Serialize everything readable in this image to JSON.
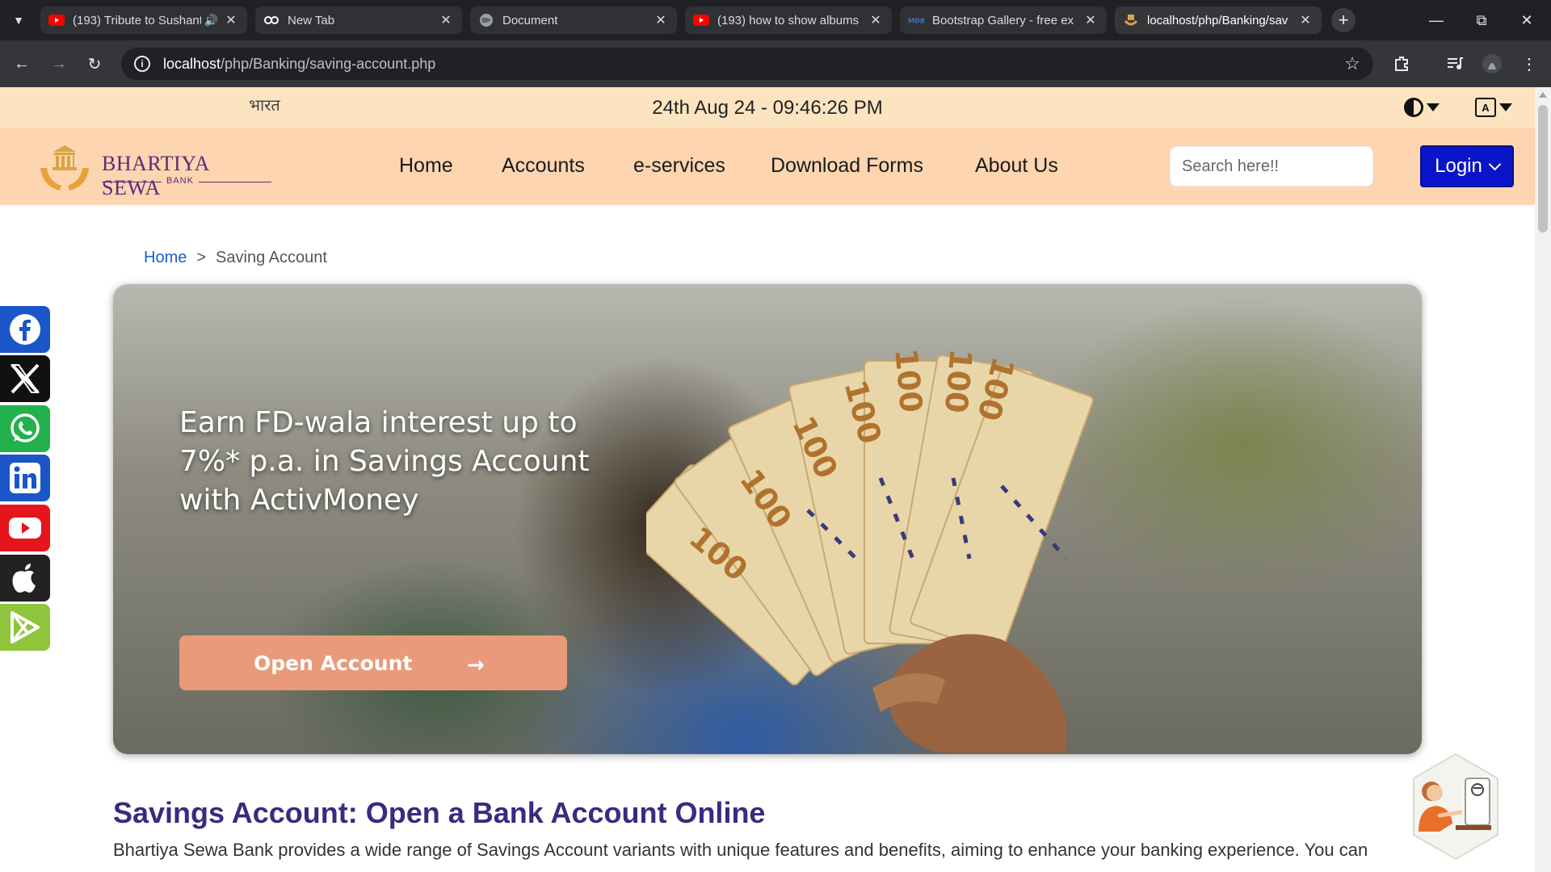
{
  "browser": {
    "tabs": [
      {
        "title": "(193) Tribute to Sushant",
        "favicon": "youtube-icon",
        "audio": true,
        "active": false
      },
      {
        "title": "New Tab",
        "favicon": "infinity-icon",
        "audio": false,
        "active": false
      },
      {
        "title": "Document",
        "favicon": "globe-icon",
        "audio": false,
        "active": false
      },
      {
        "title": "(193) how to show albums",
        "favicon": "youtube-icon",
        "audio": false,
        "active": false
      },
      {
        "title": "Bootstrap Gallery - free ex",
        "favicon": "mdb-icon",
        "audio": false,
        "active": false
      },
      {
        "title": "localhost/php/Banking/sav",
        "favicon": "bank-logo-icon",
        "audio": false,
        "active": true
      }
    ],
    "url_host": "localhost",
    "url_path": "/php/Banking/saving-account.php"
  },
  "topbar": {
    "bharat": "भारत",
    "datetime": "24th Aug 24 - 09:46:26 PM"
  },
  "logo": {
    "name": "BHARTIYA SEWA",
    "sub": "BANK"
  },
  "nav": {
    "links": [
      "Home",
      "Accounts",
      "e-services",
      "Download Forms",
      "About Us"
    ],
    "search_placeholder": "Search here!!",
    "login_label": "Login"
  },
  "breadcrumb": {
    "home": "Home",
    "separator": ">",
    "current": "Saving Account"
  },
  "hero": {
    "title": "Earn FD-wala interest up to 7%* p.a. in Savings Account with ActivMoney",
    "button_label": "Open Account",
    "note_text": "100"
  },
  "social": [
    {
      "name": "facebook-icon",
      "color": "#1a56c8"
    },
    {
      "name": "x-icon",
      "color": "#111111"
    },
    {
      "name": "whatsapp-icon",
      "color": "#22b14c"
    },
    {
      "name": "linkedin-icon",
      "color": "#1a56c8"
    },
    {
      "name": "youtube-icon",
      "color": "#e8141c"
    },
    {
      "name": "apple-icon",
      "color": "#222222"
    },
    {
      "name": "google-play-icon",
      "color": "#8fc43d"
    }
  ],
  "section": {
    "title": "Savings Account: Open a Bank Account Online",
    "text": "Bhartiya Sewa Bank provides a wide range of Savings Account variants with unique features and benefits, aiming to enhance your banking experience. You can"
  }
}
